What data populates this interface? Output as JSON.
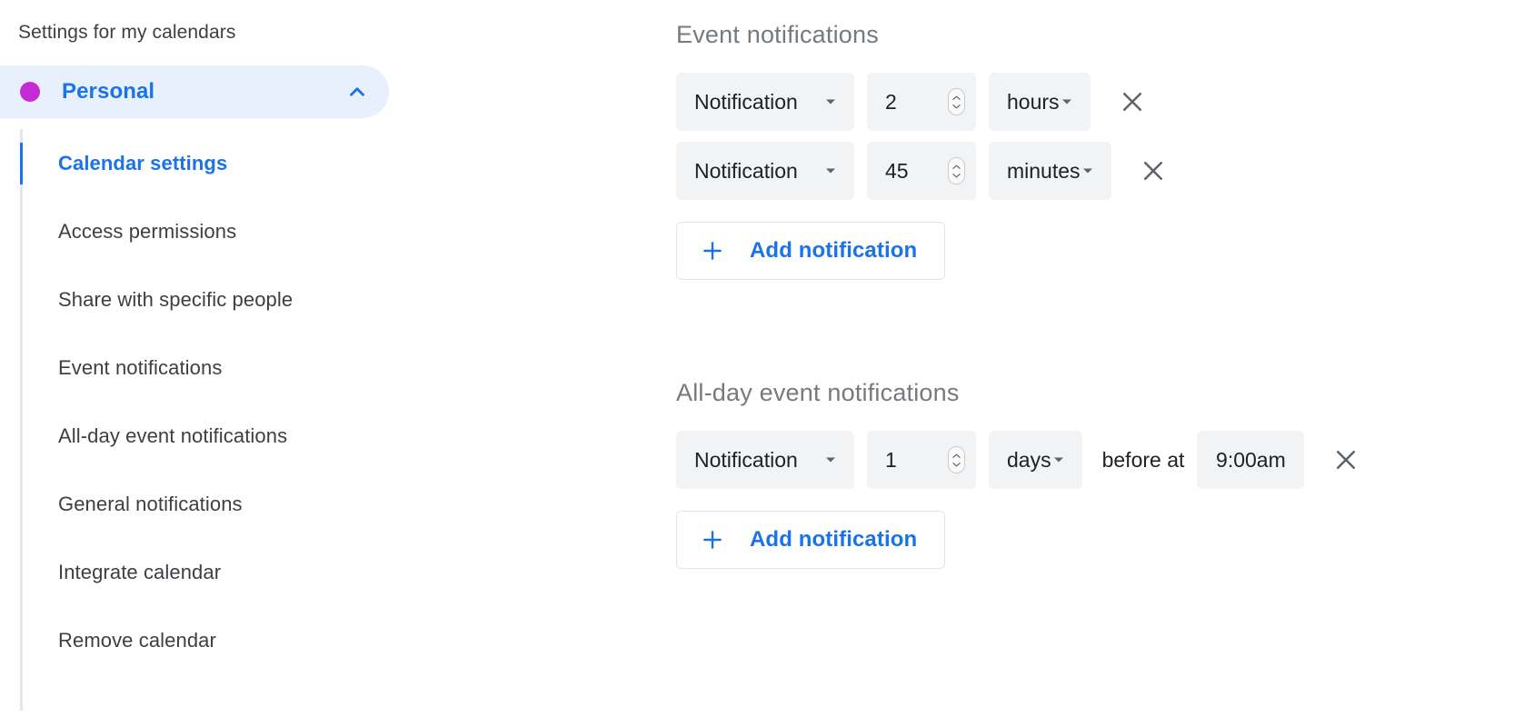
{
  "sidebar": {
    "title": "Settings for my calendars",
    "calendar": {
      "name": "Personal",
      "dot_color": "#c42bd4",
      "expanded_icon": "chevron-up-icon"
    },
    "items": [
      {
        "label": "Calendar settings",
        "active": true
      },
      {
        "label": "Access permissions",
        "active": false
      },
      {
        "label": "Share with specific people",
        "active": false
      },
      {
        "label": "Event notifications",
        "active": false
      },
      {
        "label": "All-day event notifications",
        "active": false
      },
      {
        "label": "General notifications",
        "active": false
      },
      {
        "label": "Integrate calendar",
        "active": false
      },
      {
        "label": "Remove calendar",
        "active": false
      }
    ]
  },
  "main": {
    "event_notifications": {
      "title": "Event notifications",
      "rows": [
        {
          "type": "Notification",
          "amount": "2",
          "unit": "hours"
        },
        {
          "type": "Notification",
          "amount": "45",
          "unit": "minutes"
        }
      ],
      "add_label": "Add notification"
    },
    "allday_notifications": {
      "title": "All-day event notifications",
      "rows": [
        {
          "type": "Notification",
          "amount": "1",
          "unit": "days",
          "before_label": "before at",
          "time": "9:00am"
        }
      ],
      "add_label": "Add notification"
    }
  },
  "colors": {
    "accent_blue": "#1a73e8",
    "highlight_bg": "#e8f0fe",
    "field_bg": "#f1f3f4",
    "title_gray": "#757a7f",
    "text_gray": "#3c4043"
  }
}
